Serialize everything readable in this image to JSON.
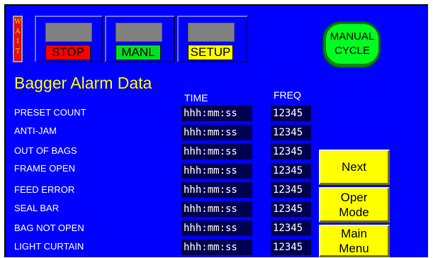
{
  "wait_indicator": [
    "W",
    "A",
    "I",
    "T"
  ],
  "mode_buttons": [
    {
      "label": "STOP",
      "color": "#ff0000"
    },
    {
      "label": "MANL",
      "color": "#00e020"
    },
    {
      "label": "SETUP",
      "color": "#ffff00"
    }
  ],
  "manual_cycle": {
    "line1": "MANUAL",
    "line2": "CYCLE",
    "color": "#00ff20"
  },
  "title": "Bagger Alarm Data",
  "columns": {
    "time": "TIME",
    "freq": "FREQ"
  },
  "alarms": [
    {
      "label": "PRESET COUNT",
      "time": "hhh:mm:ss",
      "freq": "12345"
    },
    {
      "label": "ANTI-JAM",
      "time": "hhh:mm:ss",
      "freq": "12345"
    },
    {
      "label": "OUT OF BAGS",
      "time": "hhh:mm:ss",
      "freq": "12345"
    },
    {
      "label": "FRAME OPEN",
      "time": "hhh:mm:ss",
      "freq": "12345"
    },
    {
      "label": "FEED ERROR",
      "time": "hhh:mm:ss",
      "freq": "12345"
    },
    {
      "label": "SEAL BAR",
      "time": "hhh:mm:ss",
      "freq": "12345"
    },
    {
      "label": "BAG NOT OPEN",
      "time": "hhh:mm:ss",
      "freq": "12345"
    },
    {
      "label": "LIGHT CURTAIN",
      "time": "hhh:mm:ss",
      "freq": "12345"
    }
  ],
  "nav_buttons": {
    "next": "Next",
    "oper_line1": "Oper",
    "oper_line2": "Mode",
    "main_line1": "Main",
    "main_line2": "Menu"
  }
}
